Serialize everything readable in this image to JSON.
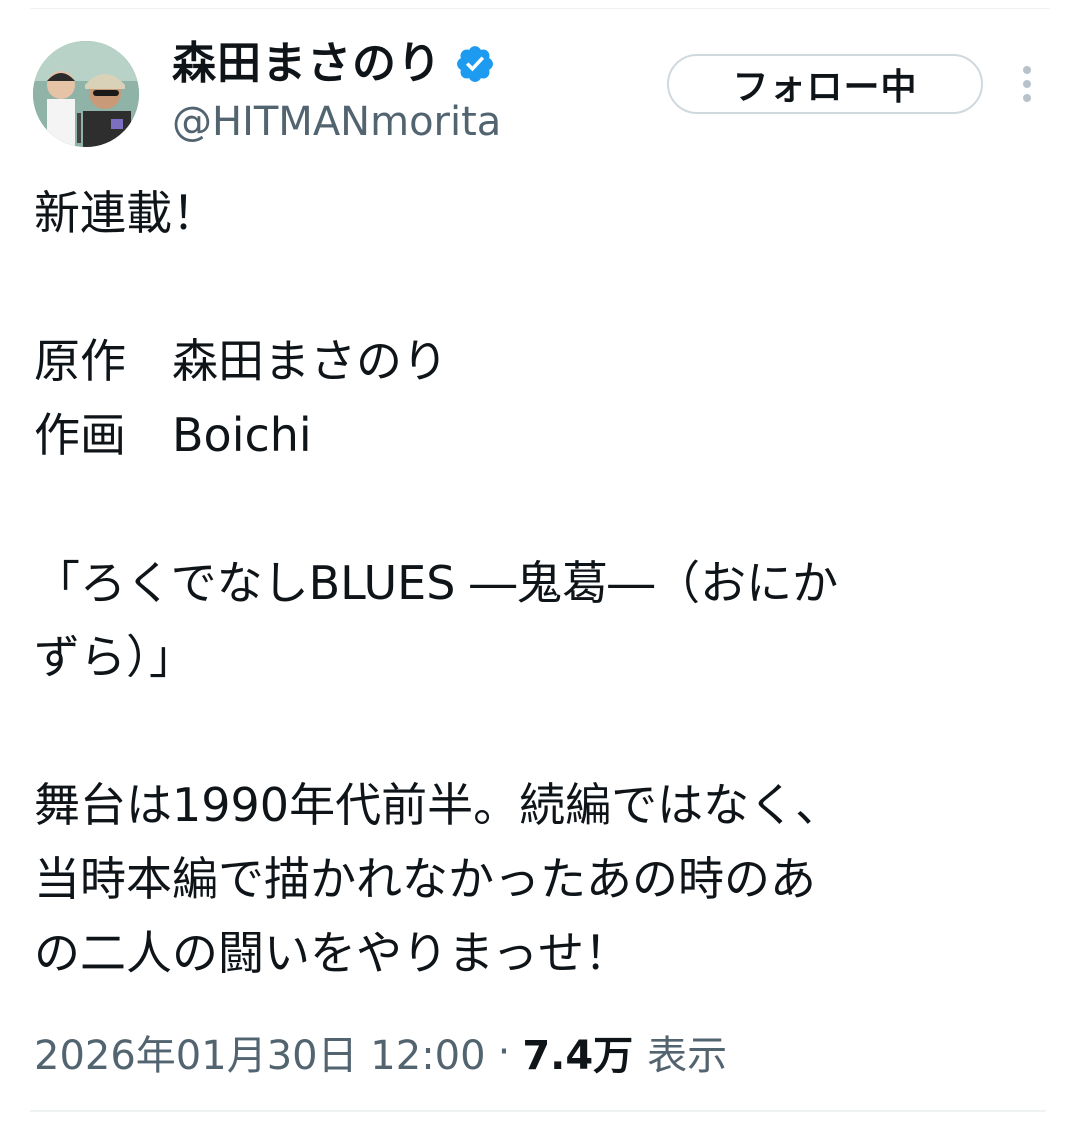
{
  "author": {
    "display_name": "森田まさのり",
    "handle": "@HITMANmorita",
    "verified_icon": "verified-badge",
    "verified_color": "#1d9bf0"
  },
  "actions": {
    "follow_label": "フォロー中",
    "more_icon": "more-vertical-icon"
  },
  "tweet": {
    "lines": [
      "新連載！",
      "",
      "原作　森田まさのり",
      "作画　Boichi",
      "",
      "「ろくでなしBLUES ―鬼葛―（おにか",
      "ずら）」",
      "",
      "舞台は1990年代前半。続編ではなく、",
      "当時本編で描かれなかったあの時のあ",
      "の二人の闘いをやりまっせ！"
    ]
  },
  "meta": {
    "datetime": "2026年01月30日 12:00",
    "separator": "·",
    "views_count": "7.4万",
    "views_label": "表示"
  }
}
